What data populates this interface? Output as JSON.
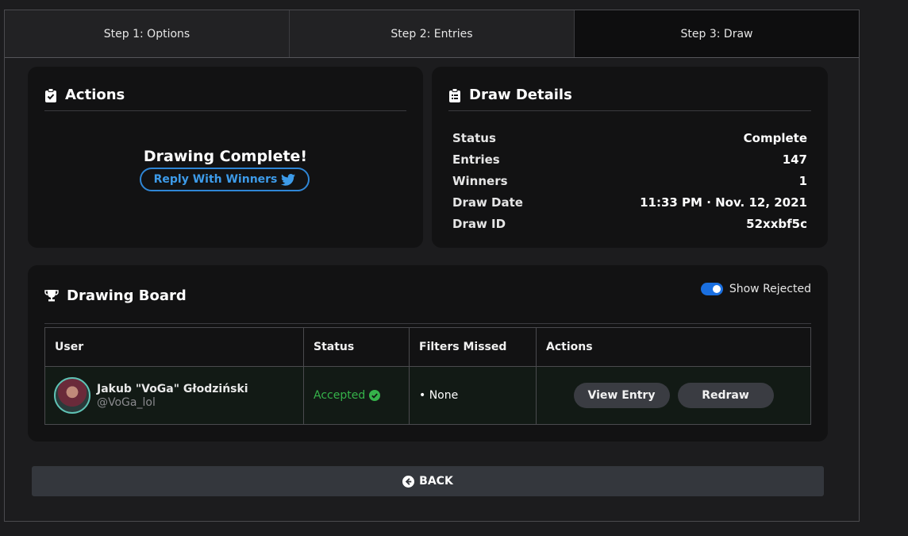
{
  "tabs": [
    {
      "label": "Step 1: Options"
    },
    {
      "label": "Step 2: Entries"
    },
    {
      "label": "Step 3: Draw"
    }
  ],
  "actions": {
    "title": "Actions",
    "complete_text": "Drawing Complete!",
    "reply_label": "Reply With Winners"
  },
  "details": {
    "title": "Draw Details",
    "rows": [
      {
        "key": "Status",
        "value": "Complete"
      },
      {
        "key": "Entries",
        "value": "147"
      },
      {
        "key": "Winners",
        "value": "1"
      },
      {
        "key": "Draw Date",
        "value": "11:33 PM · Nov. 12, 2021"
      },
      {
        "key": "Draw ID",
        "value": "52xxbf5c"
      }
    ]
  },
  "board": {
    "title": "Drawing Board",
    "toggle_label": "Show Rejected",
    "columns": [
      "User",
      "Status",
      "Filters Missed",
      "Actions"
    ],
    "rows": [
      {
        "name": "Jakub \"VoGa\" Głodziński",
        "handle": "@VoGa_lol",
        "status": "Accepted",
        "filters": "• None",
        "view_label": "View Entry",
        "redraw_label": "Redraw"
      }
    ]
  },
  "back_label": "BACK",
  "colors": {
    "accent_blue": "#3d9be9",
    "accepted_green": "#35b24a",
    "toggle_on": "#1a6fe0"
  }
}
